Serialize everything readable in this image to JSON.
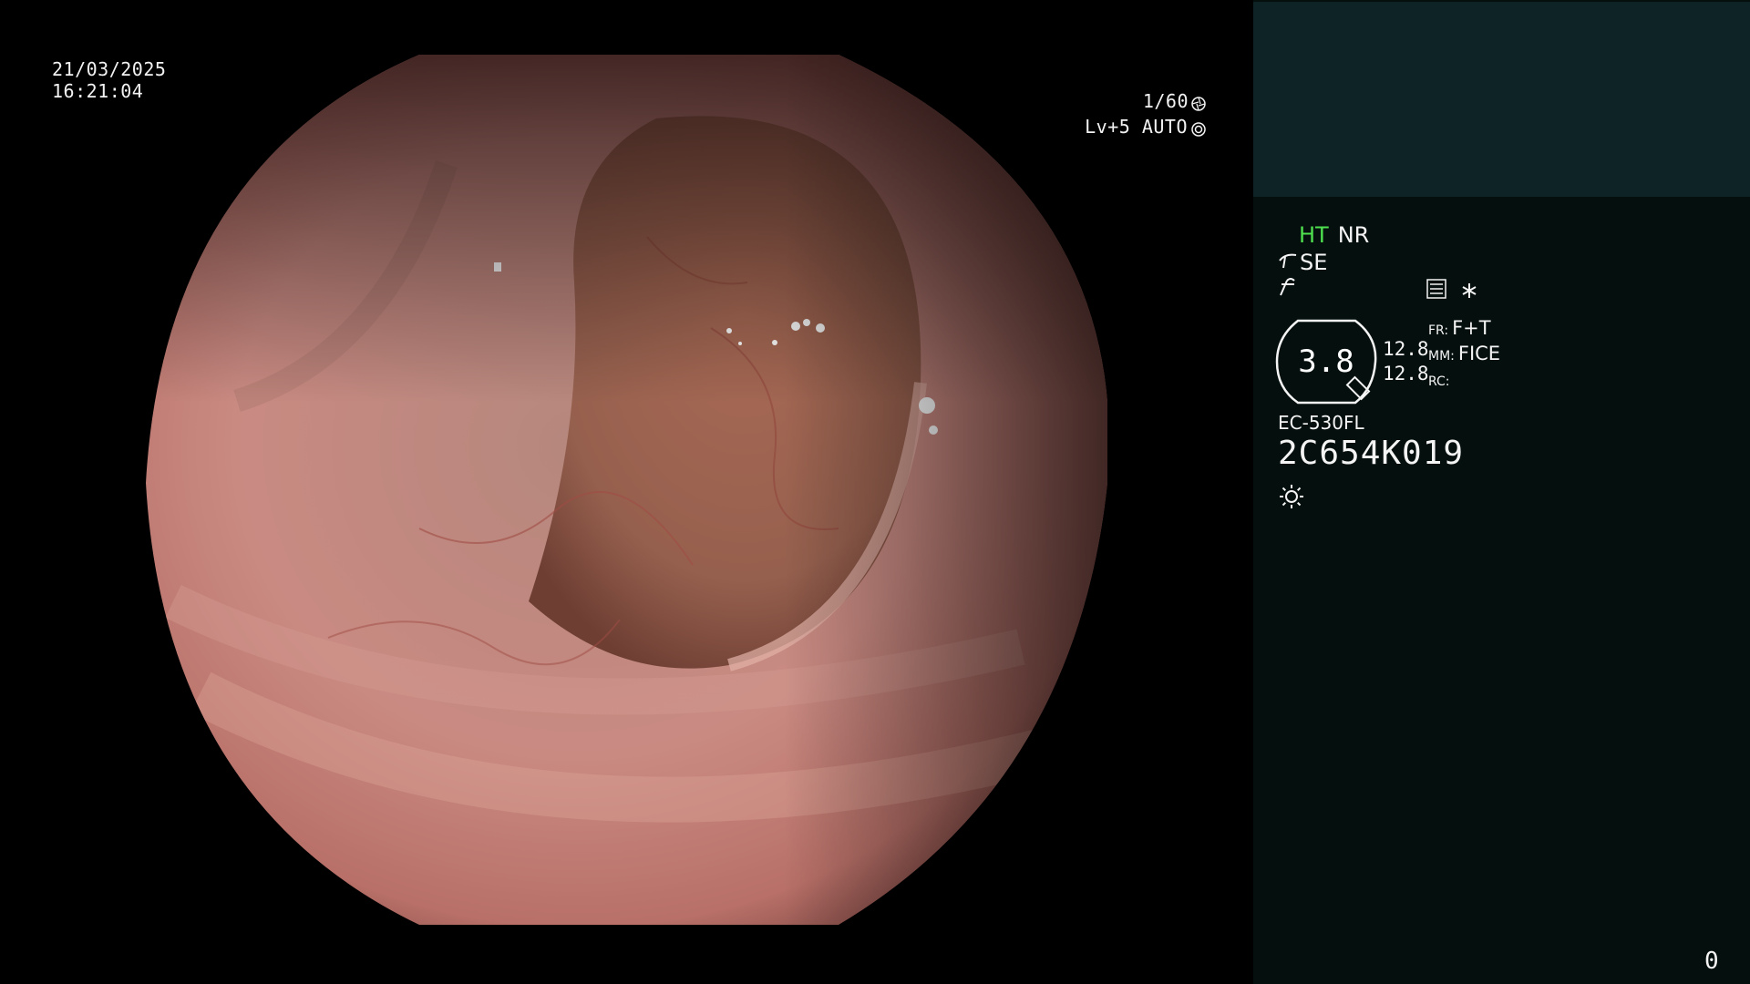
{
  "overlay": {
    "date": "21/03/2025",
    "time": "16:21:04",
    "shutter": "1/60",
    "level": "Lv+5 AUTO"
  },
  "panel": {
    "ht": "HT",
    "nr": "NR",
    "se": "SE",
    "zoom": "3.8",
    "num1": "12.8",
    "num2": "12.8",
    "fr_label": "FR:",
    "fr_value": "F+T",
    "mm_label": "MM:",
    "mm_value": "FICE",
    "rc_label": "RC:",
    "model": "EC-530FL",
    "serial": "2C654K019",
    "counter": "0"
  },
  "colors": {
    "panel_bg": "#050f0e",
    "panel_header": "#0d2325",
    "ht_green": "#4ee04e",
    "mucosa": "#c07870"
  },
  "icons": [
    "aperture-icon",
    "auto-iris-icon",
    "scope-bend-icon",
    "structure-enhance-icon",
    "menu-list-icon",
    "asterisk-icon",
    "zoom-lens-icon",
    "light-sun-icon"
  ]
}
